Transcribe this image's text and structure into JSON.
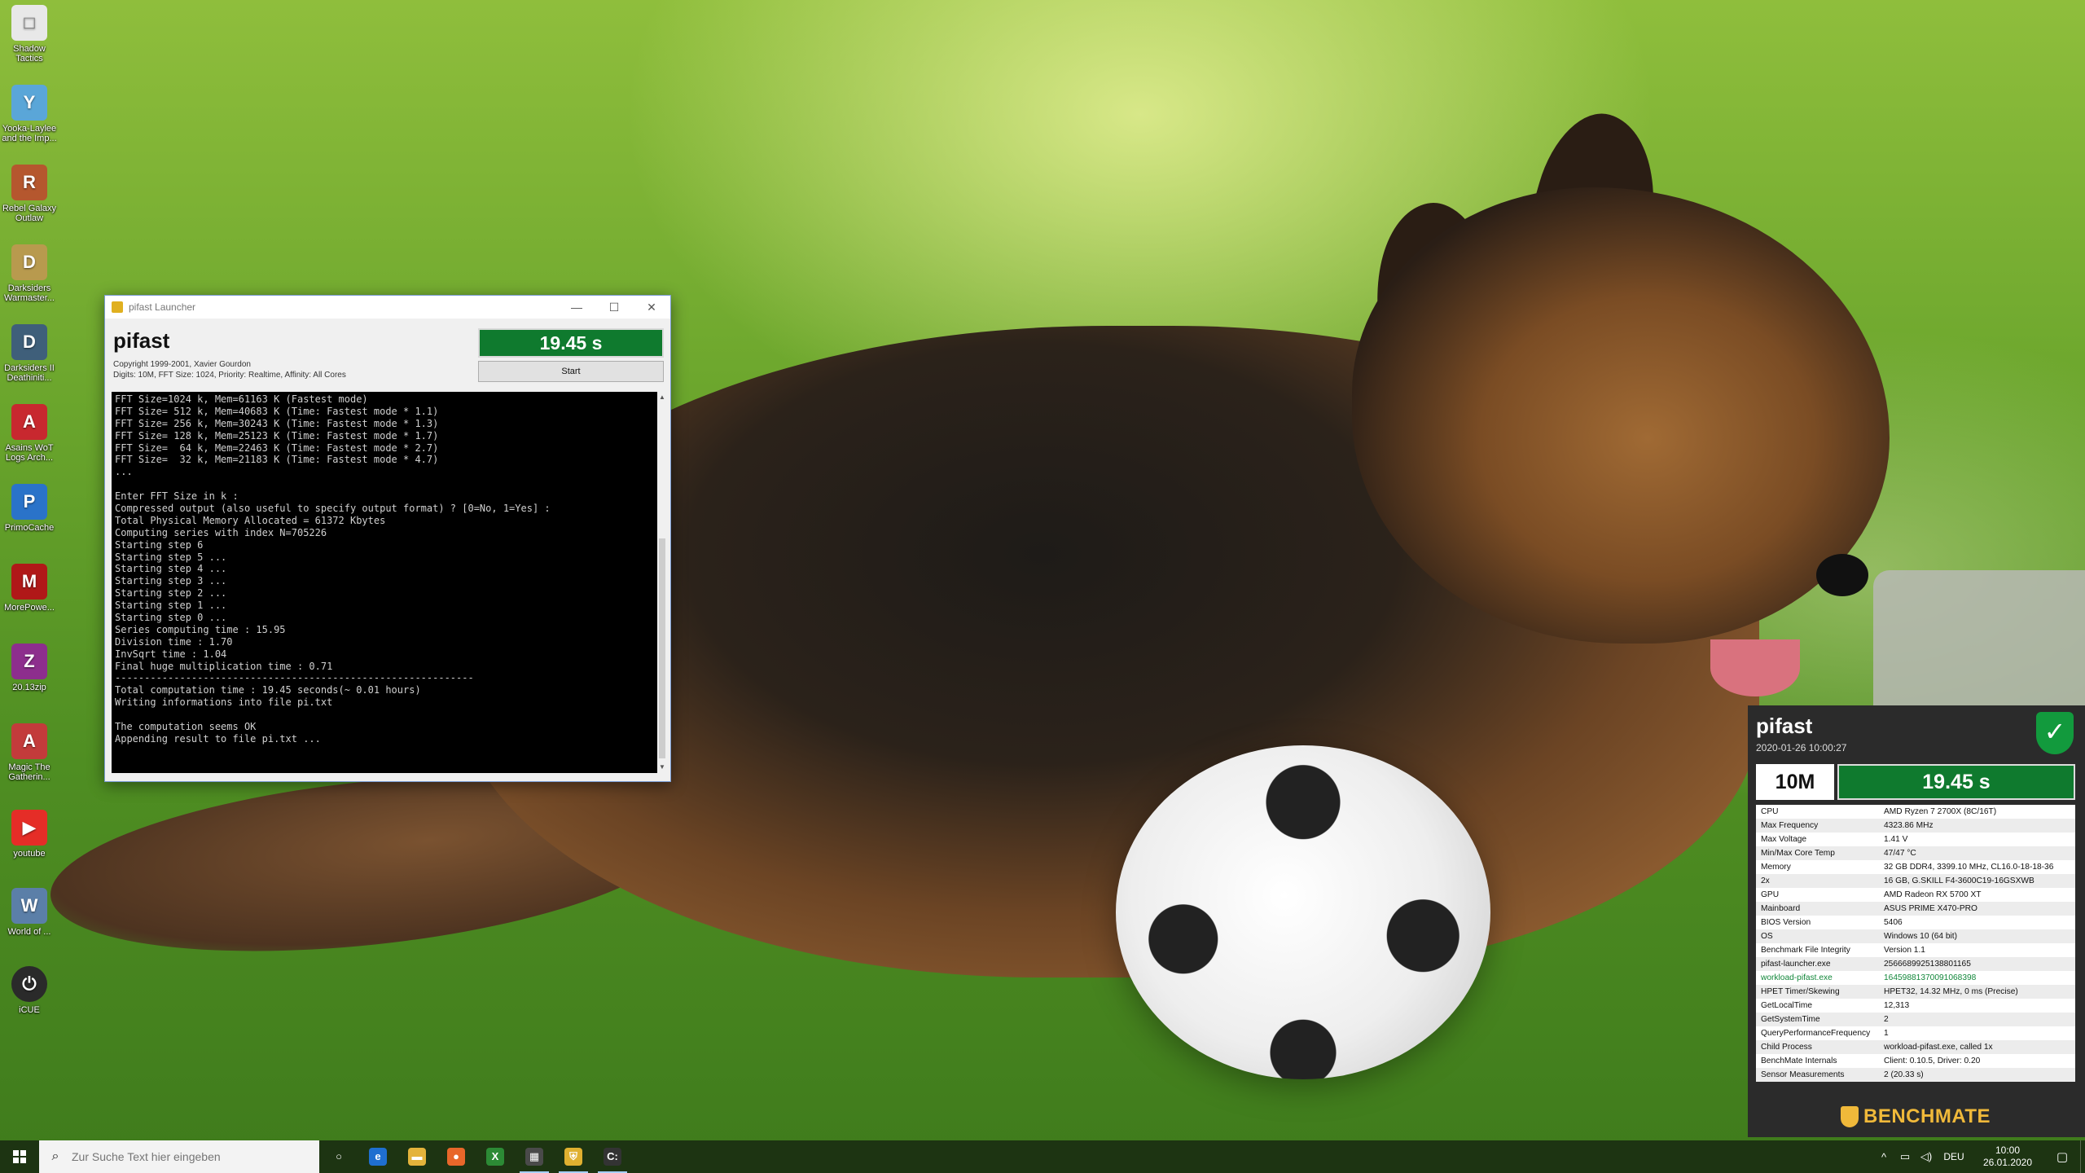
{
  "desktop": {
    "icons": [
      {
        "label": "Shadow Tactics",
        "glyph": "□",
        "color": "#e8e8e8"
      },
      {
        "label": "Yooka-Laylee and the Imp...",
        "glyph": "Y",
        "color": "#5aa6d8"
      },
      {
        "label": "Rebel Galaxy Outlaw",
        "glyph": "R",
        "color": "#b5572e"
      },
      {
        "label": "Darksiders Warmaster...",
        "glyph": "D",
        "color": "#b89a4e"
      },
      {
        "label": "Darksiders II Deathiniti...",
        "glyph": "D",
        "color": "#3f5f7a"
      },
      {
        "label": "Asains WoT Logs Arch...",
        "glyph": "A",
        "color": "#c8282f"
      },
      {
        "label": "PrimoCache",
        "glyph": "P",
        "color": "#2a73c9"
      },
      {
        "label": "MorePowe...",
        "glyph": "M",
        "color": "#b01818"
      },
      {
        "label": "20.13zip",
        "glyph": "Z",
        "color": "#8d2e8d"
      },
      {
        "label": "Magic The Gatherin...",
        "glyph": "A",
        "color": "#c33b3b"
      },
      {
        "label": "youtube",
        "glyph": "▶",
        "color": "#e52d27"
      },
      {
        "label": "World of ...",
        "glyph": "W",
        "color": "#5b7fa8"
      },
      {
        "label": "iCUE",
        "glyph": "⏻",
        "color": "#2a2a2a"
      }
    ]
  },
  "pifast_window": {
    "title": "pifast Launcher",
    "controls": {
      "minimize": "—",
      "maximize": "☐",
      "close": "✕"
    },
    "app_name": "pifast",
    "copyright": "Copyright 1999-2001, Xavier Gourdon",
    "params": "Digits: 10M, FFT Size: 1024, Priority: Realtime, Affinity: All Cores",
    "result": "19.45 s",
    "start_label": "Start",
    "console_lines": [
      "FFT Size=1024 k, Mem=61163 K (Fastest mode)",
      "FFT Size= 512 k, Mem=40683 K (Time: Fastest mode * 1.1)",
      "FFT Size= 256 k, Mem=30243 K (Time: Fastest mode * 1.3)",
      "FFT Size= 128 k, Mem=25123 K (Time: Fastest mode * 1.7)",
      "FFT Size=  64 k, Mem=22463 K (Time: Fastest mode * 2.7)",
      "FFT Size=  32 k, Mem=21183 K (Time: Fastest mode * 4.7)",
      "...",
      "",
      "Enter FFT Size in k :",
      "Compressed output (also useful to specify output format) ? [0=No, 1=Yes] :",
      "Total Physical Memory Allocated = 61372 Kbytes",
      "Computing series with index N=705226",
      "Starting step 6",
      "Starting step 5 ...",
      "Starting step 4 ...",
      "Starting step 3 ...",
      "Starting step 2 ...",
      "Starting step 1 ...",
      "Starting step 0 ...",
      "Series computing time : 15.95",
      "Division time : 1.70",
      "InvSqrt time : 1.04",
      "Final huge multiplication time : 0.71",
      "-------------------------------------------------------------",
      "Total computation time : 19.45 seconds(~ 0.01 hours)",
      "Writing informations into file pi.txt",
      "",
      "The computation seems OK",
      "Appending result to file pi.txt ..."
    ],
    "scroll_up": "▲",
    "scroll_down": "▼"
  },
  "benchmate": {
    "title": "pifast",
    "timestamp": "2020-01-26 10:00:27",
    "shield_check": "✓",
    "digits": "10M",
    "time": "19.45 s",
    "rows": [
      {
        "key": "CPU",
        "value": "AMD Ryzen 7 2700X (8C/16T)",
        "highlight": false
      },
      {
        "key": "Max Frequency",
        "value": "4323.86 MHz",
        "highlight": false
      },
      {
        "key": "Max Voltage",
        "value": "1.41 V",
        "highlight": false
      },
      {
        "key": "Min/Max Core Temp",
        "value": "47/47 °C",
        "highlight": false
      },
      {
        "key": "Memory",
        "value": "32 GB DDR4, 3399.10 MHz, CL16.0-18-18-36",
        "highlight": false
      },
      {
        "key": "2x",
        "value": "16 GB, G.SKILL F4-3600C19-16GSXWB",
        "highlight": false
      },
      {
        "key": "GPU",
        "value": "AMD Radeon RX 5700 XT",
        "highlight": false
      },
      {
        "key": "Mainboard",
        "value": "ASUS PRIME X470-PRO",
        "highlight": false
      },
      {
        "key": "BIOS Version",
        "value": "5406",
        "highlight": false
      },
      {
        "key": "OS",
        "value": "Windows 10 (64 bit)",
        "highlight": false
      },
      {
        "key": "Benchmark File Integrity",
        "value": "Version 1.1",
        "highlight": false
      },
      {
        "key": "pifast-launcher.exe",
        "value": "2566689925138801165",
        "highlight": false
      },
      {
        "key": "workload-pifast.exe",
        "value": "16459881370091068398",
        "highlight": true
      },
      {
        "key": "HPET Timer/Skewing",
        "value": "HPET32, 14.32 MHz, 0 ms (Precise)",
        "highlight": false
      },
      {
        "key": "GetLocalTime",
        "value": "12,313",
        "highlight": false
      },
      {
        "key": "GetSystemTime",
        "value": "2",
        "highlight": false
      },
      {
        "key": "QueryPerformanceFrequency",
        "value": "1",
        "highlight": false
      },
      {
        "key": "Child Process",
        "value": "workload-pifast.exe, called 1x",
        "highlight": false
      },
      {
        "key": "BenchMate Internals",
        "value": "Client: 0.10.5, Driver: 0.20",
        "highlight": false
      },
      {
        "key": "Sensor Measurements",
        "value": "2 (20.33 s)",
        "highlight": false
      }
    ],
    "logo_text": "BENCHMATE"
  },
  "taskbar": {
    "search_placeholder": "Zur Suche Text hier eingeben",
    "search_icon": "⌕",
    "apps": [
      {
        "name": "task-view",
        "glyph": "○",
        "color": "transparent",
        "active": false
      },
      {
        "name": "edge",
        "glyph": "e",
        "color": "#1f6fd0",
        "active": false
      },
      {
        "name": "file-explorer",
        "glyph": "▬",
        "color": "#e4b33b",
        "active": false
      },
      {
        "name": "firefox",
        "glyph": "●",
        "color": "#e8672a",
        "active": false
      },
      {
        "name": "xbox",
        "glyph": "X",
        "color": "#2c8a35",
        "active": false
      },
      {
        "name": "calculator",
        "glyph": "▦",
        "color": "#4a4a4a",
        "active": true
      },
      {
        "name": "benchmate",
        "glyph": "⛨",
        "color": "#e0b030",
        "active": true
      },
      {
        "name": "console",
        "glyph": "C:",
        "color": "#333333",
        "active": true
      }
    ],
    "tray": {
      "chevron": "^",
      "network": "▭",
      "volume": "◁)",
      "language": "DEU",
      "time": "10:00",
      "date": "26.01.2020",
      "notifications": "▢"
    }
  }
}
